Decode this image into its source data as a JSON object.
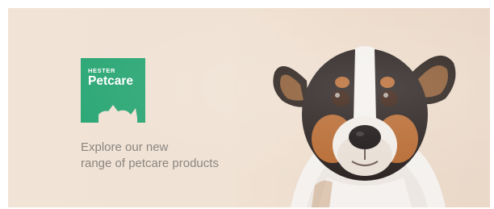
{
  "brand": {
    "top_text": "HESTER",
    "name": "Petcare",
    "color": "#2fa877"
  },
  "tagline": {
    "line1": "Explore our new",
    "line2": "range of petcare products"
  },
  "colors": {
    "background": "#f0e2d4",
    "tagline_text": "#8a8580"
  },
  "image": {
    "subject": "dog-photo"
  }
}
